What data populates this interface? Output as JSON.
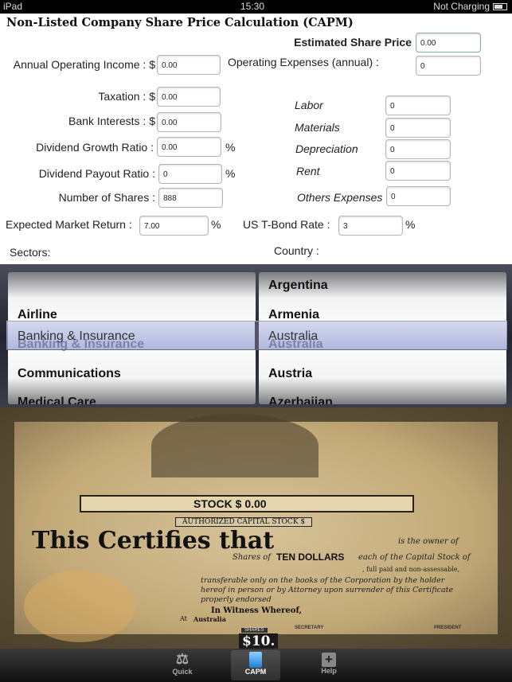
{
  "status_bar": {
    "device": "iPad",
    "time": "15:30",
    "battery": "Not Charging"
  },
  "title": "Non-Listed Company Share Price Calculation (CAPM)",
  "form": {
    "estimated_share_price": {
      "label": "Estimated Share Price",
      "value": "0.00"
    },
    "annual_operating_income": {
      "label": "Annual Operating Income : $",
      "value": "0.00"
    },
    "operating_expenses": {
      "label": "Operating Expenses (annual) :",
      "value": "0"
    },
    "taxation": {
      "label": "Taxation : $",
      "value": "0.00"
    },
    "bank_interests": {
      "label": "Bank Interests : $",
      "value": "0.00"
    },
    "dividend_growth_ratio": {
      "label": "Dividend Growth Ratio :",
      "value": "0.00",
      "unit": "%"
    },
    "dividend_payout_ratio": {
      "label": "Dividend Payout Ratio :",
      "value": "0",
      "unit": "%"
    },
    "number_of_shares": {
      "label": "Number of Shares :",
      "value": "888"
    },
    "expected_market_return": {
      "label": "Expected Market Return :",
      "value": "7.00",
      "unit": "%"
    },
    "us_tbond_rate": {
      "label": "US T-Bond Rate :",
      "value": "3",
      "unit": "%"
    },
    "labor": {
      "label": "Labor",
      "value": "0"
    },
    "materials": {
      "label": "Materials",
      "value": "0"
    },
    "depreciation": {
      "label": "Depreciation",
      "value": "0"
    },
    "rent": {
      "label": "Rent",
      "value": "0"
    },
    "others_expenses": {
      "label": "Others Expenses",
      "value": "0"
    },
    "sectors_label": "Sectors:",
    "country_label": "Country :"
  },
  "picker": {
    "sectors": [
      "",
      "Airline",
      "Banking & Insurance",
      "Communications",
      "Medical Care"
    ],
    "countries": [
      "Argentina",
      "Armenia",
      "Australia",
      "Austria",
      "Azerbaijan"
    ],
    "selected_sector": "Banking & Insurance",
    "selected_country": "Australia"
  },
  "certificate": {
    "stock": "STOCK $ 0.00",
    "authorized": "AUTHORIZED CAPITAL STOCK $",
    "certifies": "This Certifies that",
    "owner": "is the owner of",
    "shares_of": "Shares of",
    "par": "TEN DOLLARS",
    "each": "each of the Capital Stock of",
    "full_paid": ", full paid and non-assessable,",
    "body": "transferable only on the books of the Corporation by the holder hereof in person or by Attorney upon surrender of this Certificate properly endorsed",
    "witness": "In Witness Whereof,",
    "at": "At",
    "location": "Australia",
    "secretary": "SECRETARY",
    "president": "PRESIDENT",
    "shares_label": "SHARES",
    "denomination": "$10."
  },
  "tabbar": {
    "tabs": [
      {
        "label": "Quick",
        "icon": "scales-icon"
      },
      {
        "label": "CAPM",
        "icon": "calculator-icon",
        "active": true
      },
      {
        "label": "Help",
        "icon": "plus-icon"
      }
    ]
  }
}
